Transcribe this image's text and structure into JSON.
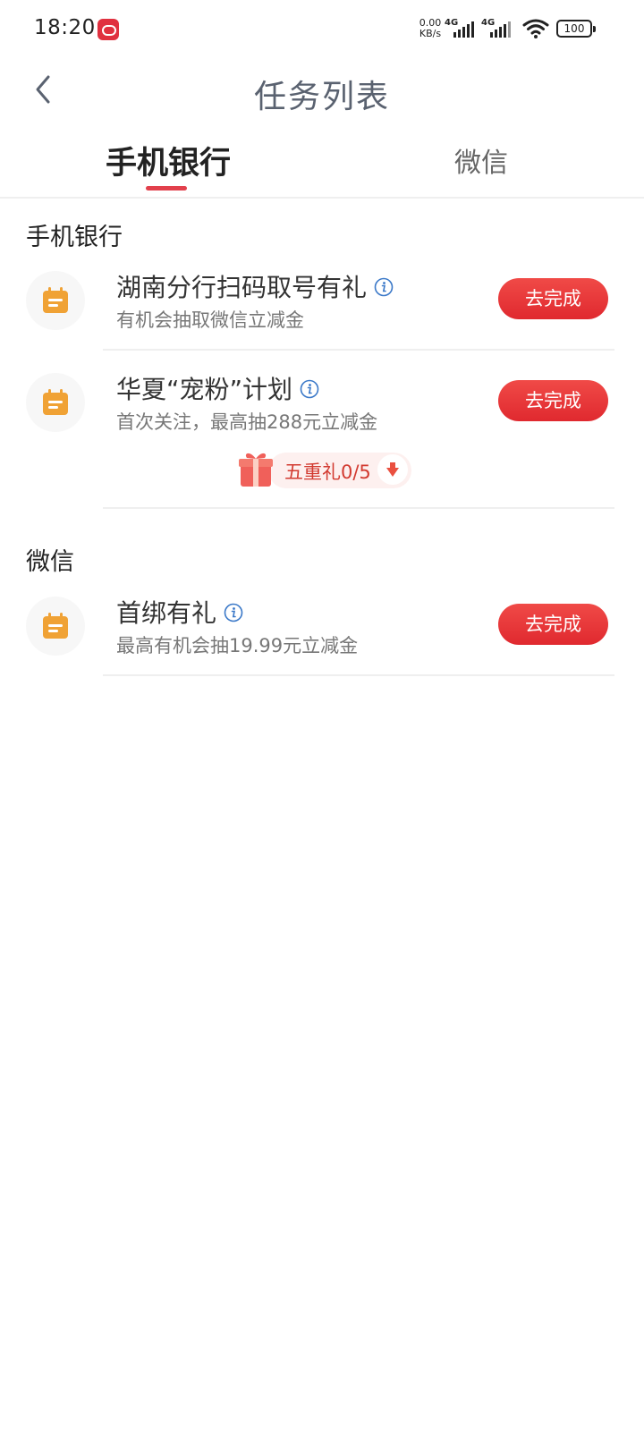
{
  "status_bar": {
    "time": "18:20",
    "net_speed_value": "0.00",
    "net_speed_unit": "KB/s",
    "signal_1": "4G",
    "signal_2": "4G",
    "battery": "100"
  },
  "header": {
    "title": "任务列表",
    "back_icon": "chevron-left-icon"
  },
  "tabs": [
    {
      "label": "手机银行",
      "active": true
    },
    {
      "label": "微信",
      "active": false
    }
  ],
  "sections": [
    {
      "title": "手机银行",
      "tasks": [
        {
          "title": "湖南分行扫码取号有礼",
          "description": "有机会抽取微信立减金",
          "button": "去完成",
          "icon": "calendar-icon"
        },
        {
          "title": "华夏“宠粉”计划",
          "description": "首次关注，最高抽288元立减金",
          "button": "去完成",
          "icon": "calendar-icon",
          "reward": {
            "label": "五重礼0/5",
            "icon": "gift-icon"
          }
        }
      ]
    },
    {
      "title": "微信",
      "tasks": [
        {
          "title": "首绑有礼",
          "description": "最高有机会抽19.99元立减金",
          "button": "去完成",
          "icon": "calendar-icon"
        }
      ]
    }
  ],
  "colors": {
    "accent": "#e2404c",
    "button": "#e53535",
    "icon_orange": "#f0a235",
    "info_blue": "#3a78c8"
  }
}
